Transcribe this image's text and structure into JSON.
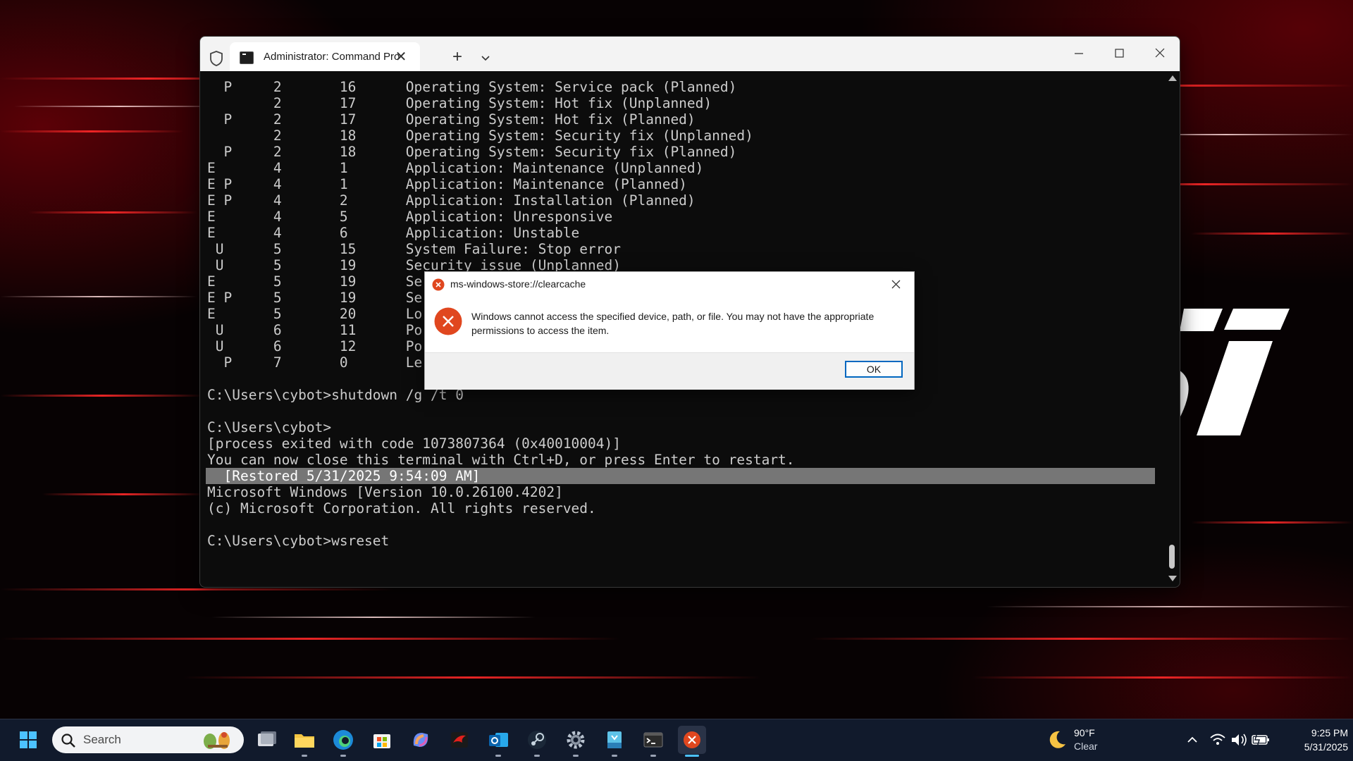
{
  "terminal": {
    "tab_title": "Administrator: Command Pro",
    "lines": [
      "  P     2       16      Operating System: Service pack (Planned)",
      "        2       17      Operating System: Hot fix (Unplanned)",
      "  P     2       17      Operating System: Hot fix (Planned)",
      "        2       18      Operating System: Security fix (Unplanned)",
      "  P     2       18      Operating System: Security fix (Planned)",
      "E       4       1       Application: Maintenance (Unplanned)",
      "E P     4       1       Application: Maintenance (Planned)",
      "E P     4       2       Application: Installation (Planned)",
      "E       4       5       Application: Unresponsive",
      "E       4       6       Application: Unstable",
      " U      5       15      System Failure: Stop error",
      " U      5       19      Security issue (Unplanned)",
      "E       5       19      Se",
      "E P     5       19      Se",
      "E       5       20      Lo",
      " U      6       11      Po",
      " U      6       12      Po",
      "  P     7       0       Le",
      "",
      "C:\\Users\\cybot>shutdown /g /t 0",
      "",
      "C:\\Users\\cybot>",
      "[process exited with code 1073807364 (0x40010004)]",
      "You can now close this terminal with Ctrl+D, or press Enter to restart.",
      "  [Restored 5/31/2025 9:54:09 AM]",
      "Microsoft Windows [Version 10.0.26100.4202]",
      "(c) Microsoft Corporation. All rights reserved.",
      "",
      "C:\\Users\\cybot>wsreset"
    ],
    "highlight_line_index": 24
  },
  "dialog": {
    "title": "ms-windows-store://clearcache",
    "message": "Windows cannot access the specified device, path, or file. You may not have the appropriate permissions to access the item.",
    "ok_label": "OK"
  },
  "taskbar": {
    "search_placeholder": "Search",
    "apps": [
      "task-view",
      "file-explorer",
      "edge",
      "microsoft-store",
      "copilot",
      "msi-center",
      "outlook",
      "steam",
      "settings",
      "media-creation-tool",
      "terminal",
      "error-dialog"
    ],
    "active_app": "error-dialog"
  },
  "weather": {
    "temp": "90°F",
    "desc": "Clear"
  },
  "clock": {
    "time": "9:25 PM",
    "date": "5/31/2025"
  },
  "colors": {
    "accent": "#0067c0",
    "error": "#e0471f",
    "taskbar": "#111a2c",
    "terminal_bg": "#0c0c0c"
  }
}
